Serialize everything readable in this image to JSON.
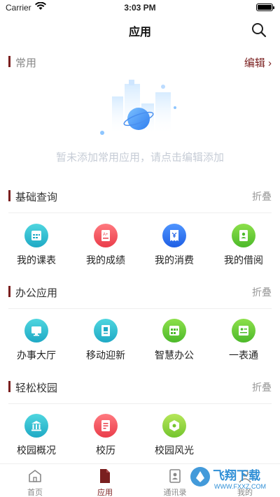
{
  "status": {
    "carrier": "Carrier",
    "time": "3:03 PM"
  },
  "nav": {
    "title": "应用"
  },
  "common": {
    "title": "常用",
    "edit_label": "编辑 ›",
    "empty_text": "暂未添加常用应用，请点击编辑添加"
  },
  "sections": [
    {
      "title": "基础查询",
      "action": "折叠",
      "apps": [
        {
          "label": "我的课表",
          "icon": "calendar-icon",
          "color": "#2cb8d3"
        },
        {
          "label": "我的成绩",
          "icon": "score-icon",
          "color": "#ef4b56"
        },
        {
          "label": "我的消费",
          "icon": "receipt-icon",
          "color": "#2f73ef"
        },
        {
          "label": "我的借阅",
          "icon": "book-icon",
          "color": "#5cc535"
        }
      ]
    },
    {
      "title": "办公应用",
      "action": "折叠",
      "apps": [
        {
          "label": "办事大厅",
          "icon": "monitor-icon",
          "color": "#2cb8d3"
        },
        {
          "label": "移动迎新",
          "icon": "flag-icon",
          "color": "#2cb8d3"
        },
        {
          "label": "智慧办公",
          "icon": "grid-icon",
          "color": "#5cc535"
        },
        {
          "label": "一表通",
          "icon": "form-icon",
          "color": "#5cc535"
        }
      ]
    },
    {
      "title": "轻松校园",
      "action": "折叠",
      "apps": [
        {
          "label": "校园概况",
          "icon": "building-icon",
          "color": "#2cb8d3"
        },
        {
          "label": "校历",
          "icon": "note-icon",
          "color": "#ef4b56"
        },
        {
          "label": "校园风光",
          "icon": "photo-icon",
          "color": "#7fcd36"
        }
      ]
    }
  ],
  "tabs": [
    {
      "label": "首页",
      "icon": "home-icon"
    },
    {
      "label": "应用",
      "icon": "document-icon"
    },
    {
      "label": "通讯录",
      "icon": "contacts-icon"
    },
    {
      "label": "我的",
      "icon": "user-icon"
    }
  ],
  "watermark": {
    "brand": "飞翔下载",
    "url": "WWW.FXXZ.COM"
  }
}
